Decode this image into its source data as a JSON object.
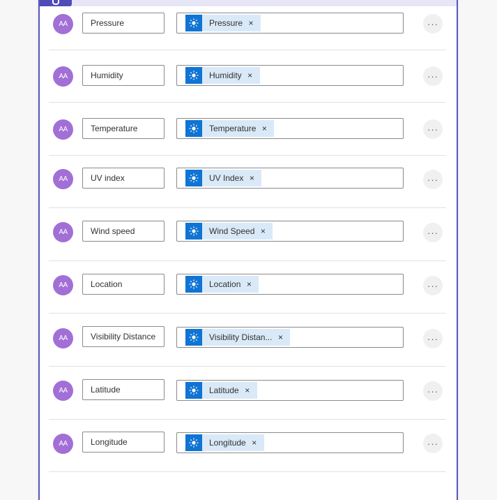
{
  "rows": [
    {
      "name": "Pressure",
      "token": "Pressure"
    },
    {
      "name": "Humidity",
      "token": "Humidity"
    },
    {
      "name": "Temperature",
      "token": "Temperature"
    },
    {
      "name": "UV index",
      "token": "UV Index"
    },
    {
      "name": "Wind speed",
      "token": "Wind Speed"
    },
    {
      "name": "Location",
      "token": "Location"
    },
    {
      "name": "Visibility Distance",
      "token": "Visibility Distan..."
    },
    {
      "name": "Latitude",
      "token": "Latitude"
    },
    {
      "name": "Longitude",
      "token": "Longitude"
    }
  ],
  "avatar_text": "AA",
  "token_icon": "sun-icon",
  "close_glyph": "×",
  "more_glyph": "···",
  "colors": {
    "accent": "#5b55c4",
    "avatar": "#a26fd6",
    "token_icon_bg": "#0f74d4",
    "token_bg": "#d9e9f8"
  }
}
